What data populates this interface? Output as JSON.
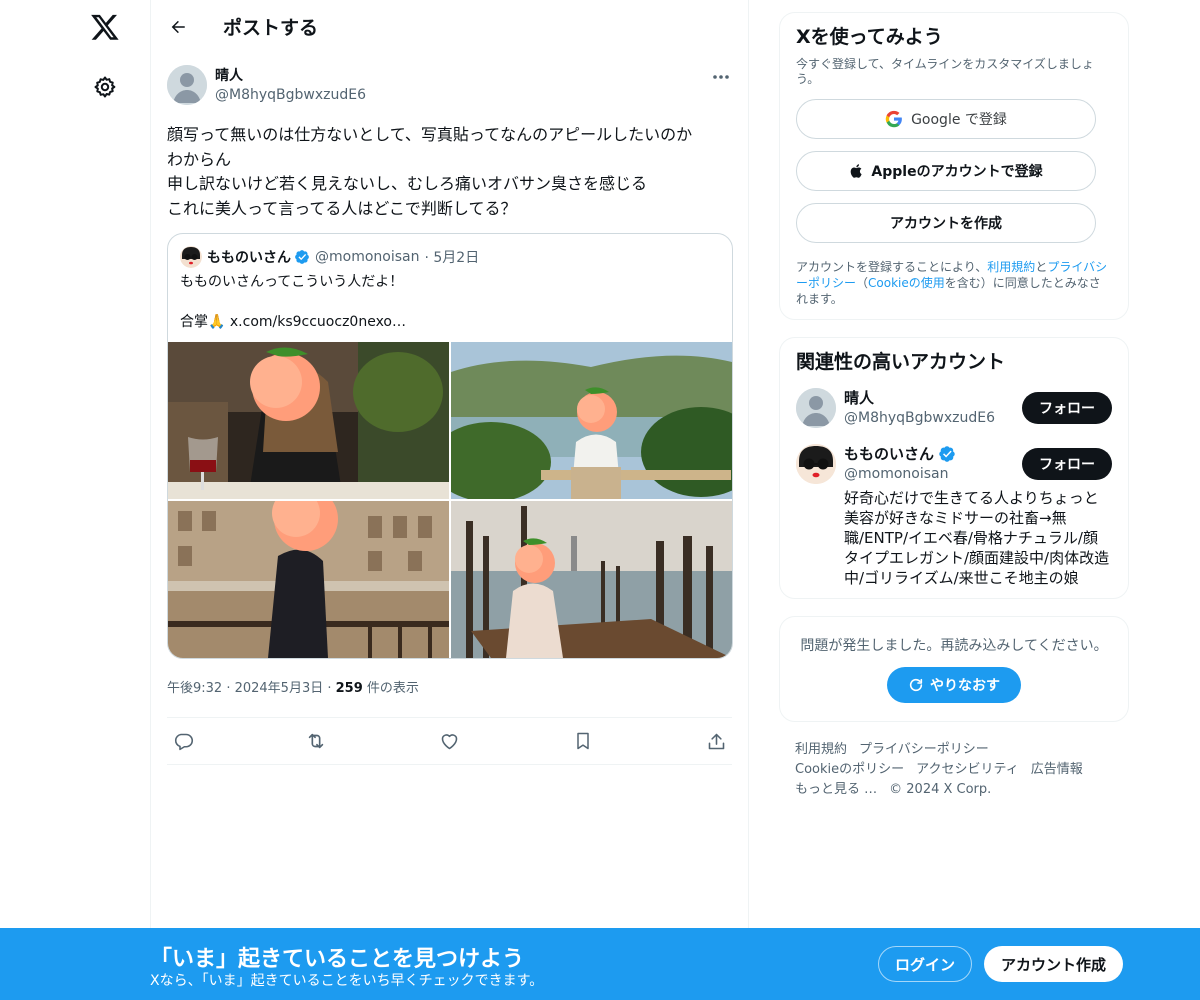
{
  "header": {
    "title": "ポストする"
  },
  "tweet": {
    "author_name": "晴人",
    "author_handle": "@M8hyqBgbwxzudE6",
    "text": "顔写って無いのは仕方ないとして、写真貼ってなんのアピールしたいのか\nわからん\n申し訳ないけど若く見えないし、むしろ痛いオバサン臭さを感じる\nこれに美人って言ってる人はどこで判断してる？",
    "quote": {
      "name": "もものいさん",
      "handle": "@momonoisan",
      "date": "· 5月2日",
      "text": "もものいさんってこういう人だよ！\n\n合掌🙏 x.com/ks9ccuocz0nexo…"
    },
    "meta_time": "午後9:32 · 2024年5月3日 · ",
    "views": "259",
    "views_suffix": " 件の表示"
  },
  "signup_card": {
    "title": "Xを使ってみよう",
    "subtitle": "今すぐ登録して、タイムラインをカスタマイズしましょう。",
    "google_label": "Google で登録",
    "apple_label": "Appleのアカウントで登録",
    "create_label": "アカウントを作成",
    "legal_prefix": "アカウントを登録することにより、",
    "legal_terms": "利用規約",
    "legal_and": "と",
    "legal_privacy": "プライバシーポリシー",
    "legal_mid": "（",
    "legal_cookie": "Cookieの使用",
    "legal_suffix": "を含む）に同意したとみなされます。"
  },
  "relevant": {
    "title": "関連性の高いアカウント",
    "accounts": [
      {
        "name": "晴人",
        "handle": "@M8hyqBgbwxzudE6",
        "follow": "フォロー",
        "bio": ""
      },
      {
        "name": "もものいさん",
        "handle": "@momonoisan",
        "follow": "フォロー",
        "bio": "好奇心だけで生きてる人よりちょっと美容が好きなミドサーの社畜→無職/ENTP/イエベ春/骨格ナチュラル/顔タイプエレガント/顔面建設中/肉体改造中/ゴリライズム/来世こそ地主の娘"
      }
    ]
  },
  "error_card": {
    "text": "問題が発生しました。再読み込みしてください。",
    "retry": "やりなおす"
  },
  "footer": {
    "links": [
      "利用規約",
      "プライバシーポリシー",
      "Cookieのポリシー",
      "アクセシビリティ",
      "広告情報",
      "もっと見る …",
      "© 2024 X Corp."
    ]
  },
  "banner": {
    "title": "「いま」起きていることを見つけよう",
    "subtitle": "Xなら、「いま」起きていることをいち早くチェックできます。",
    "login": "ログイン",
    "signup": "アカウント作成"
  },
  "colors": {
    "accent": "#1d9bf0",
    "text": "#0f1419",
    "muted": "#536471",
    "border": "#cfd9de"
  },
  "icons": [
    "x-logo-icon",
    "gear-icon",
    "back-arrow-icon",
    "more-icon",
    "verified-icon",
    "reply-icon",
    "repost-icon",
    "like-icon",
    "bookmark-icon",
    "share-icon",
    "google-icon",
    "apple-icon",
    "refresh-icon"
  ]
}
